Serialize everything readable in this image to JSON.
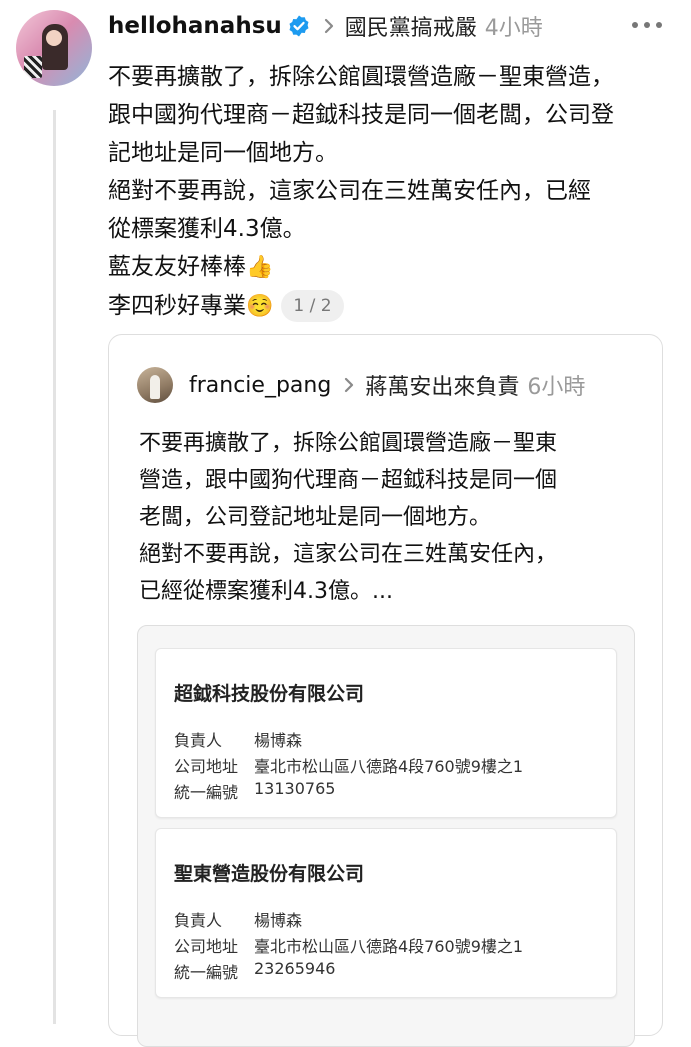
{
  "post": {
    "username": "hellohanahsu",
    "topic": "國民黨搞戒嚴",
    "time": "4小時",
    "lines": [
      "不要再擴散了，拆除公館圓環營造廠－聖東營造，",
      "跟中國狗代理商－超鉞科技是同一個老闆，公司登",
      "記地址是同一個地方。",
      "絕對不要再說，這家公司在三姓萬安任內，已經",
      "從標案獲利4.3億。",
      "藍友友好棒棒",
      "李四秒好專業"
    ],
    "emoji_thumbs": "👍",
    "emoji_smile": "☺️",
    "pager": "1 / 2"
  },
  "quote": {
    "username": "francie_pang",
    "topic": "蔣萬安出來負責",
    "time": "6小時",
    "lines": [
      "不要再擴散了，拆除公館圓環營造廠－聖東",
      "營造，跟中國狗代理商－超鉞科技是同一個",
      "老闆，公司登記地址是同一個地方。",
      "絕對不要再說，這家公司在三姓萬安任內，",
      "已經從標案獲利4.3億。..."
    ]
  },
  "companies": [
    {
      "name": "超鉞科技股份有限公司",
      "owner_label": "負責人",
      "owner": "楊博森",
      "address_label": "公司地址",
      "address": "臺北市松山區八德路4段760號9樓之1",
      "id_label": "統一編號",
      "id": "13130765"
    },
    {
      "name": "聖東營造股份有限公司",
      "owner_label": "負責人",
      "owner": "楊博森",
      "address_label": "公司地址",
      "address": "臺北市松山區八德路4段760號9樓之1",
      "id_label": "統一編號",
      "id": "23265946"
    }
  ],
  "colors": {
    "verified": "#1d9bf0",
    "muted": "#9a9a9a"
  },
  "icons": [
    "verified-badge-icon",
    "chevron-right-icon",
    "more-options-icon"
  ]
}
